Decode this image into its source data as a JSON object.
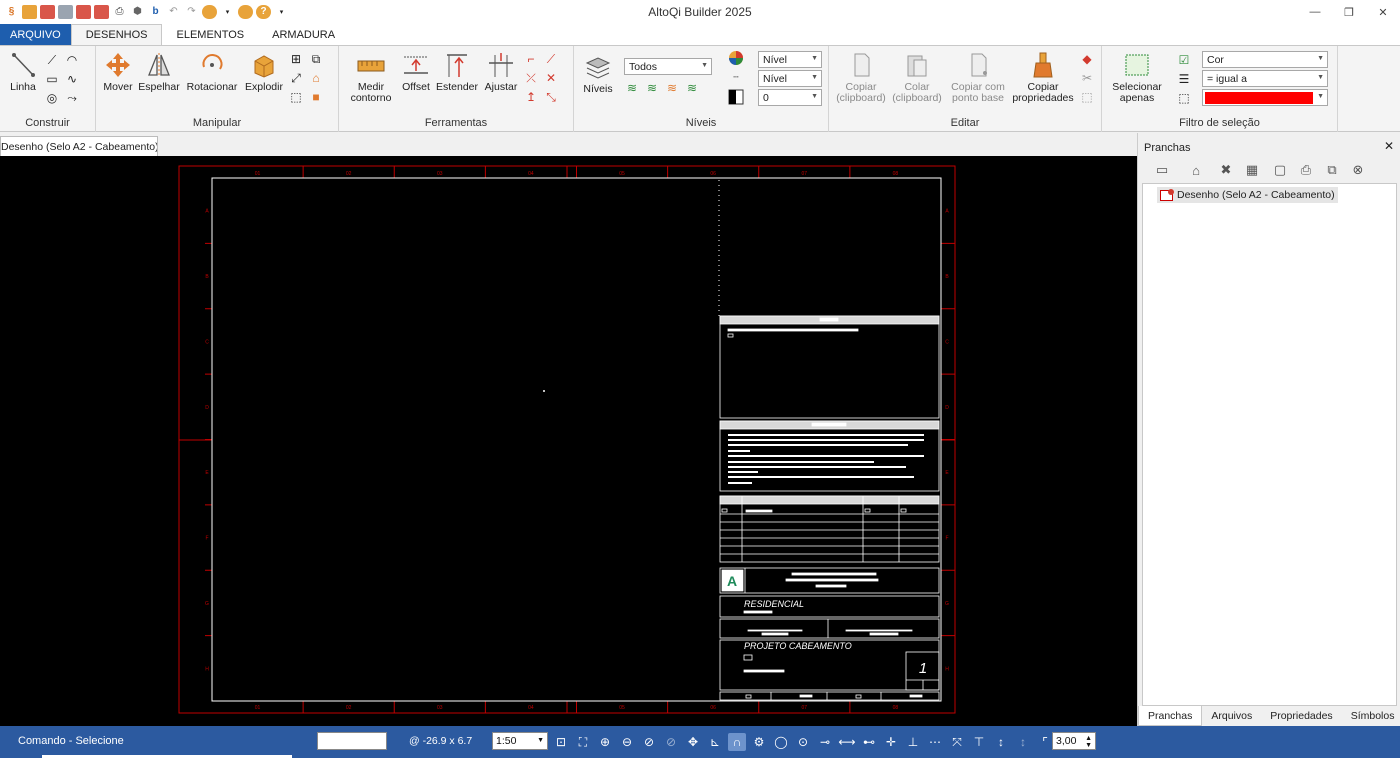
{
  "app": {
    "title": "AltoQi Builder 2025"
  },
  "menu_tabs": [
    {
      "label": "ARQUIVO"
    },
    {
      "label": "DESENHOS"
    },
    {
      "label": "ELEMENTOS"
    },
    {
      "label": "ARMADURA"
    }
  ],
  "ribbon": {
    "construir": {
      "label": "Construir",
      "linha": "Linha"
    },
    "manipular": {
      "label": "Manipular",
      "mover": "Mover",
      "espelhar": "Espelhar",
      "rotacionar": "Rotacionar",
      "explodir": "Explodir"
    },
    "ferramentas": {
      "label": "Ferramentas",
      "medir1": "Medir",
      "medir2": "contorno",
      "offset": "Offset",
      "estender": "Estender",
      "ajustar": "Ajustar"
    },
    "niveis": {
      "label": "Níveis",
      "button": "Níveis",
      "filter": "Todos",
      "color_mode": "Nível",
      "line_mode": "Nível",
      "thickness": "0"
    },
    "editar": {
      "label": "Editar",
      "copiar1": "Copiar",
      "copiar2": "(clipboard)",
      "colar1": "Colar",
      "colar2": "(clipboard)",
      "copiarpb1": "Copiar com",
      "copiarpb2": "ponto base",
      "copiarprop1": "Copiar",
      "copiarprop2": "propriedades"
    },
    "filtro": {
      "label": "Filtro de seleção",
      "sel1": "Selecionar",
      "sel2": "apenas",
      "property": "Cor",
      "operator": "= igual a",
      "value_color": "#ff0000"
    }
  },
  "document": {
    "tab_label": "Desenho (Selo A2 - Cabeamento)",
    "drawing": {
      "col_labels": [
        "01",
        "02",
        "03",
        "04",
        "05",
        "06",
        "07",
        "08"
      ],
      "row_labels": [
        "A",
        "B",
        "C",
        "D",
        "E",
        "F",
        "G",
        "H"
      ],
      "selo_title1": "RESIDENCIAL",
      "selo_title2": "PROJETO CABEAMENTO",
      "sheet_number": "1",
      "logo_letter": "A"
    }
  },
  "panel": {
    "title": "Pranchas",
    "tree_item": "Desenho (Selo A2 - Cabeamento)",
    "tabs": [
      {
        "label": "Pranchas"
      },
      {
        "label": "Arquivos"
      },
      {
        "label": "Propriedades"
      },
      {
        "label": "Símbolos"
      }
    ]
  },
  "status": {
    "command": "Comando - Selecione",
    "coords": "@ -26.9 x 6.7",
    "scale": "1:50",
    "value": "3,00"
  }
}
